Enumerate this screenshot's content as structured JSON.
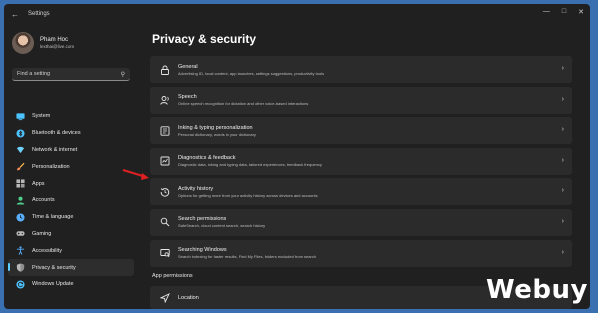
{
  "window": {
    "title": "Settings"
  },
  "profile": {
    "name": "Pham Hoc",
    "email": "lexthai@live.com"
  },
  "search": {
    "placeholder": "Find a setting"
  },
  "sidebar": {
    "items": [
      {
        "label": "System",
        "icon": "monitor-icon",
        "color": "#4cc2ff"
      },
      {
        "label": "Bluetooth & devices",
        "icon": "bluetooth-icon",
        "color": "#4cc2ff"
      },
      {
        "label": "Network & internet",
        "icon": "network-icon",
        "color": "#6fd1ff"
      },
      {
        "label": "Personalization",
        "icon": "brush-icon",
        "color": "#ffb84d"
      },
      {
        "label": "Apps",
        "icon": "apps-icon",
        "color": "#b8b8b8"
      },
      {
        "label": "Accounts",
        "icon": "accounts-icon",
        "color": "#4fd08c"
      },
      {
        "label": "Time & language",
        "icon": "clock-icon",
        "color": "#5ab0ff"
      },
      {
        "label": "Gaming",
        "icon": "gamepad-icon",
        "color": "#b8b8b8"
      },
      {
        "label": "Accessibility",
        "icon": "accessibility-icon",
        "color": "#5ab0ff"
      },
      {
        "label": "Privacy & security",
        "icon": "shield-icon",
        "color": "#b8b8b8",
        "active": true
      },
      {
        "label": "Windows Update",
        "icon": "update-icon",
        "color": "#4cc2ff"
      }
    ]
  },
  "main": {
    "title": "Privacy & security",
    "cards": [
      {
        "title": "General",
        "desc": "Advertising ID, local content, app launches, settings suggestions, productivity tools",
        "icon": "lock-icon"
      },
      {
        "title": "Speech",
        "desc": "Online speech recognition for dictation and other voice-based interactions",
        "icon": "speech-icon"
      },
      {
        "title": "Inking & typing personalization",
        "desc": "Personal dictionary, words in your dictionary",
        "icon": "inking-icon"
      },
      {
        "title": "Diagnostics & feedback",
        "desc": "Diagnostic data, inking and typing data, tailored experiences, feedback frequency",
        "icon": "diagnostics-icon"
      },
      {
        "title": "Activity history",
        "desc": "Options for getting more from your activity history across devices and accounts",
        "icon": "history-icon"
      },
      {
        "title": "Search permissions",
        "desc": "SafeSearch, cloud content search, search history",
        "icon": "search-permissions-icon"
      },
      {
        "title": "Searching Windows",
        "desc": "Search indexing for faster results, Find My Files, folders excluded from search",
        "icon": "searching-windows-icon"
      }
    ],
    "section_label": "App permissions",
    "location": {
      "title": "Location",
      "icon": "location-icon"
    }
  },
  "watermark": {
    "text": "Webuy"
  },
  "colors": {
    "accent": "#60cdff",
    "arrow": "#e02020"
  }
}
